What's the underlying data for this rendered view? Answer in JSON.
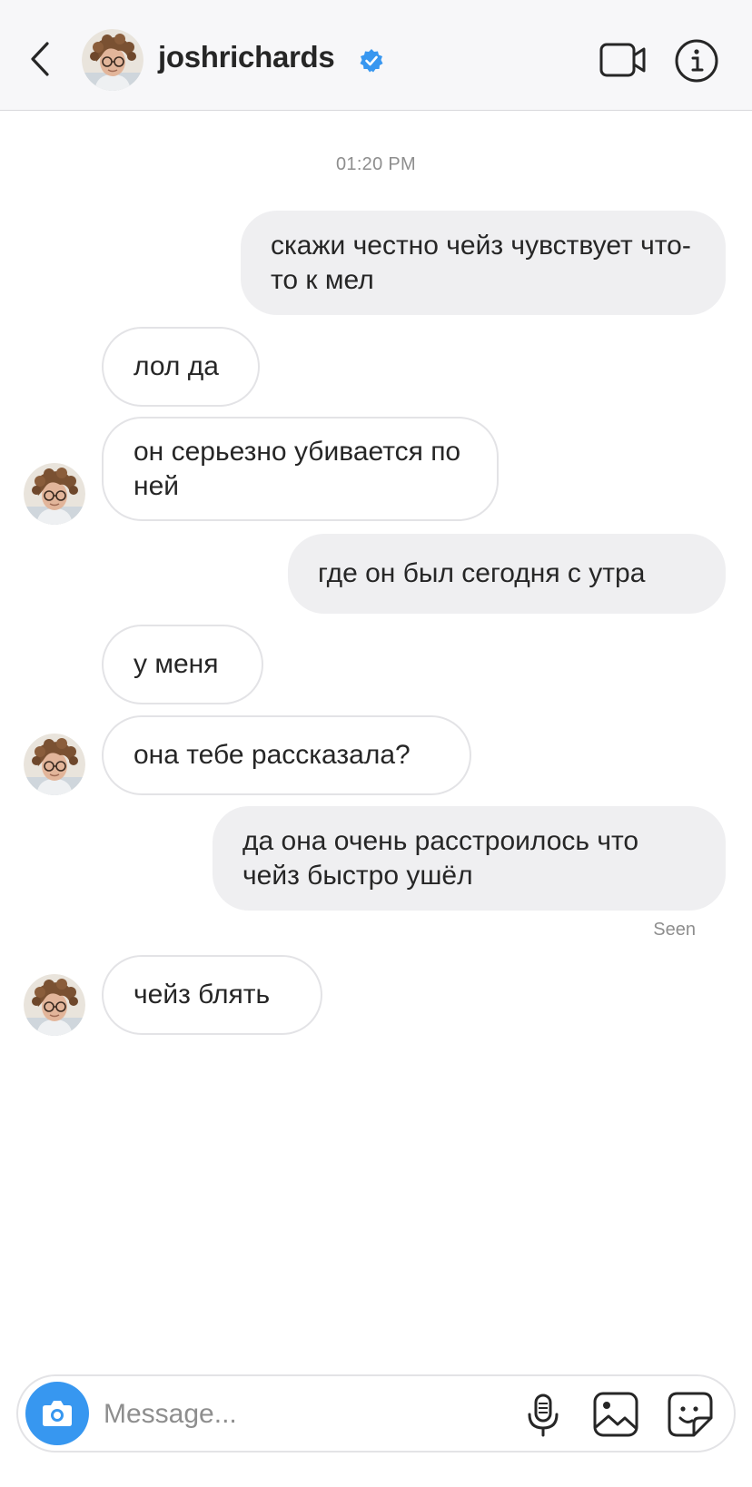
{
  "header": {
    "username": "joshrichards",
    "back_icon": "chevron-left-icon",
    "verified_icon": "verified-badge-icon",
    "video_icon": "video-camera-icon",
    "info_icon": "info-icon",
    "accent_color": "#3897f0"
  },
  "conversation": {
    "timestamp": "01:20 PM",
    "messages": [
      {
        "direction": "outgoing",
        "text": "скажи честно чейз чувствует что-то к мел"
      },
      {
        "direction": "incoming",
        "text": "лол да"
      },
      {
        "direction": "incoming",
        "text": "он серьезно убивается по ней"
      },
      {
        "direction": "outgoing",
        "text": "где он был сегодня с утра"
      },
      {
        "direction": "incoming",
        "text": "у меня"
      },
      {
        "direction": "incoming",
        "text": "она тебе рассказала?"
      },
      {
        "direction": "outgoing",
        "text": "да она очень расстроилось что чейз быстро ушёл"
      },
      {
        "direction": "incoming",
        "text": "чейз блять"
      }
    ],
    "seen_label": "Seen"
  },
  "composer": {
    "placeholder": "Message...",
    "camera_icon": "camera-icon",
    "mic_icon": "microphone-icon",
    "gallery_icon": "image-gallery-icon",
    "sticker_icon": "sticker-icon"
  },
  "colors": {
    "outgoing_bubble": "#efeff1",
    "incoming_border": "#e3e3e6",
    "camera_button": "#3797f0"
  }
}
